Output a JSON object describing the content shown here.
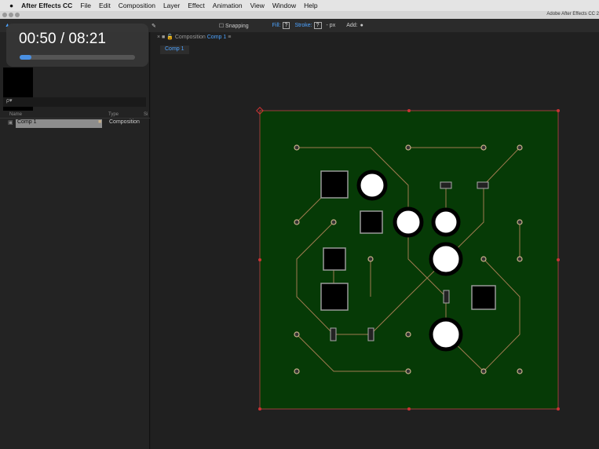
{
  "menubar": {
    "apple": "",
    "app": "After Effects CC",
    "items": [
      "File",
      "Edit",
      "Composition",
      "Layer",
      "Effect",
      "Animation",
      "View",
      "Window",
      "Help"
    ]
  },
  "window_title": "Adobe After Effects CC 2",
  "toolbar": {
    "snapping": "Snapping",
    "fill": "Fill:",
    "stroke": "Stroke:",
    "unknown": "?",
    "px": "- px",
    "add": "Add:"
  },
  "project": {
    "search_placeholder": "ρ▾",
    "col_name": "Name",
    "col_type": "Type",
    "col_size": "Si",
    "item_name": "Comp 1",
    "item_type": "Composition"
  },
  "composition": {
    "tab_prefix": "Composition",
    "tab_name": "Comp 1",
    "subtab": "Comp 1",
    "board_color": "#063a06"
  },
  "player": {
    "time": "00:50 / 08:21",
    "progress_percent": 10
  }
}
